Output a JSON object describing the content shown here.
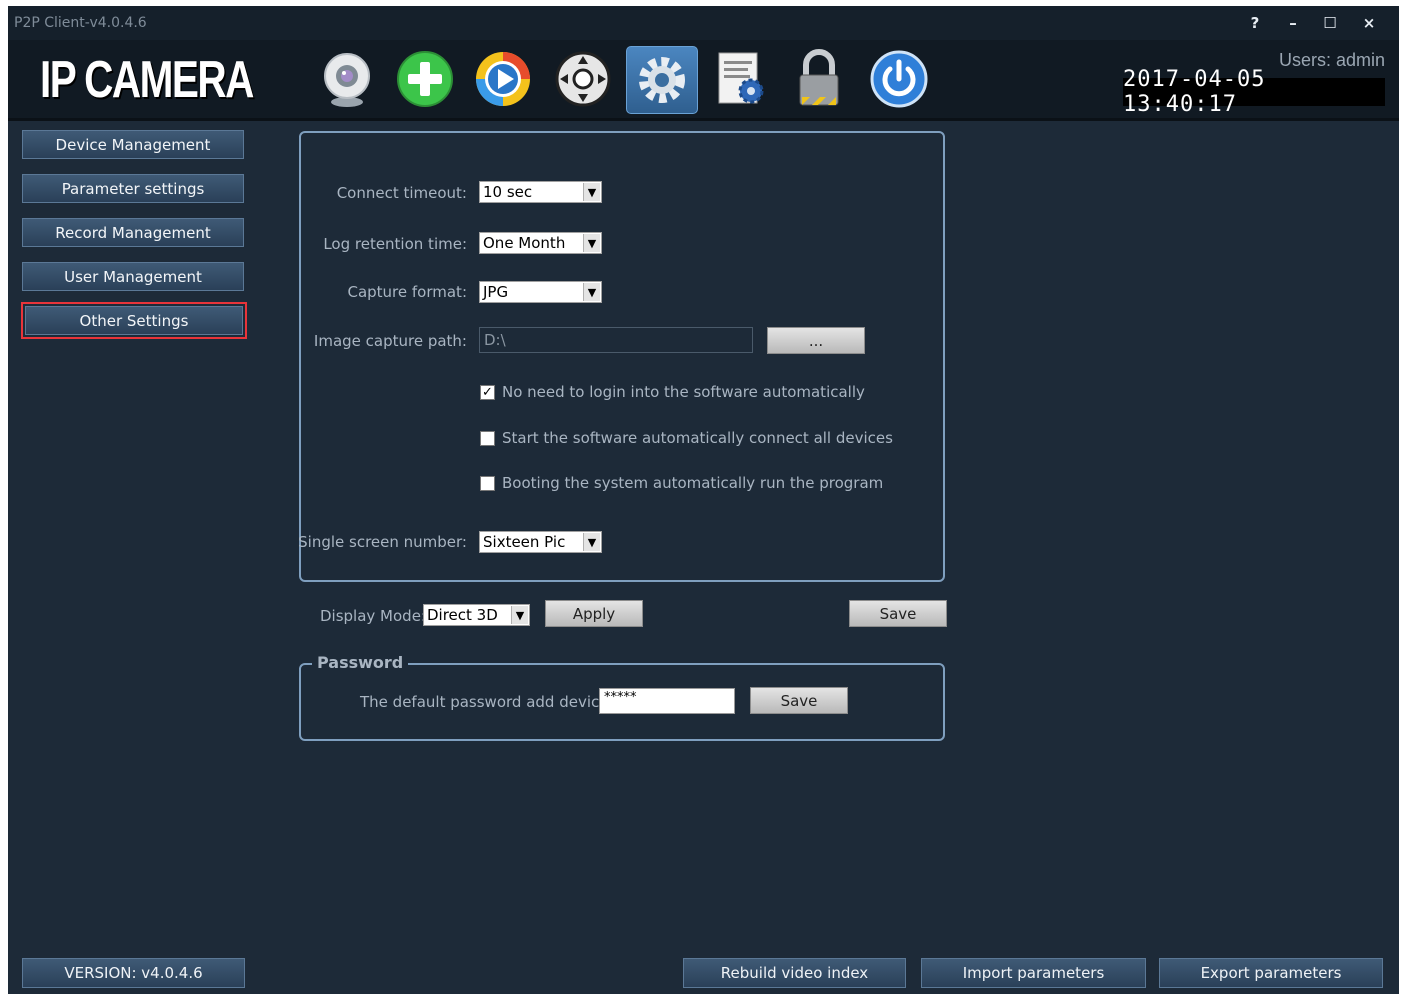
{
  "window": {
    "title": "P2P Client-v4.0.4.6",
    "controls": [
      "?",
      "–",
      "☐",
      "×"
    ]
  },
  "header": {
    "logo": "IP CAMERA",
    "users_label": "Users: admin",
    "datetime": "2017-04-05 13:40:17",
    "toolbar": [
      {
        "icon": "webcam-icon"
      },
      {
        "icon": "add-device-icon"
      },
      {
        "icon": "playback-icon"
      },
      {
        "icon": "ptz-control-icon"
      },
      {
        "icon": "settings-gear-icon",
        "active": true
      },
      {
        "icon": "log-document-icon"
      },
      {
        "icon": "lock-icon"
      },
      {
        "icon": "power-icon"
      }
    ]
  },
  "sidebar": {
    "items": [
      {
        "label": "Device Management"
      },
      {
        "label": "Parameter settings"
      },
      {
        "label": "Record Management"
      },
      {
        "label": "User Management"
      },
      {
        "label": "Other Settings",
        "selected": true
      }
    ],
    "version": "VERSION: v4.0.4.6"
  },
  "settings": {
    "connect_timeout": {
      "label": "Connect timeout:",
      "value": "10 sec"
    },
    "log_retention": {
      "label": "Log retention time:",
      "value": "One Month"
    },
    "capture_format": {
      "label": "Capture format:",
      "value": "JPG"
    },
    "capture_path": {
      "label": "Image capture path:",
      "value": "D:\\",
      "browse_label": "..."
    },
    "checkboxes": [
      {
        "label": "No need to login into the software automatically",
        "checked": true
      },
      {
        "label": "Start the software automatically connect all devices",
        "checked": false
      },
      {
        "label": "Booting the system automatically run the program",
        "checked": false
      }
    ],
    "single_screen": {
      "label": "Single screen number:",
      "value": "Sixteen Pic"
    }
  },
  "display": {
    "label": "Display Mode:",
    "value": "Direct 3D",
    "apply_label": "Apply",
    "save_label": "Save"
  },
  "password": {
    "legend": "Password",
    "label": "The default password add device",
    "value": "*****",
    "save_label": "Save"
  },
  "footer": {
    "rebuild_label": "Rebuild video index",
    "import_label": "Import parameters",
    "export_label": "Export parameters"
  },
  "colors": {
    "background": "#1d2a38",
    "header": "#111a23",
    "panel_border": "#7f9fbf",
    "selected_outline": "#e8343a"
  }
}
